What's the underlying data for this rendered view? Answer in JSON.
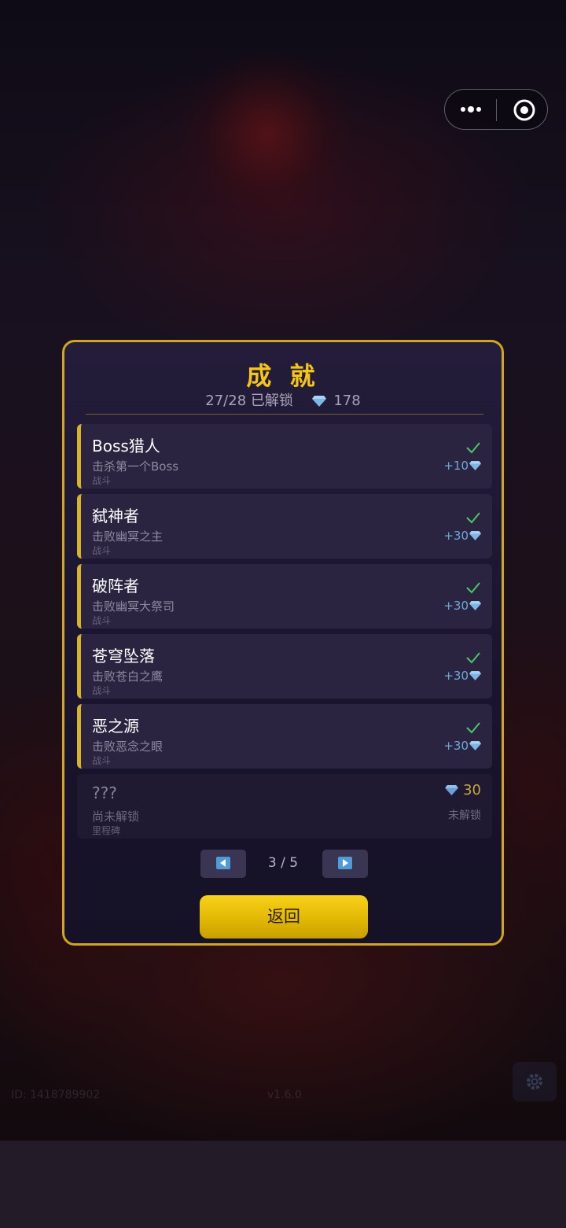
{
  "capsule": {
    "menu_icon": "more-dots-icon",
    "close_icon": "target-circle-icon"
  },
  "panel": {
    "title": "成 就",
    "unlocked_summary": "27/28 已解锁",
    "gem_total": "178",
    "achievements": [
      {
        "name": "Boss猎人",
        "desc": "击杀第一个Boss",
        "category": "战斗",
        "reward": "+10",
        "status": "unlocked"
      },
      {
        "name": "弑神者",
        "desc": "击败幽冥之主",
        "category": "战斗",
        "reward": "+30",
        "status": "unlocked"
      },
      {
        "name": "破阵者",
        "desc": "击败幽冥大祭司",
        "category": "战斗",
        "reward": "+30",
        "status": "unlocked"
      },
      {
        "name": "苍穹坠落",
        "desc": "击败苍白之鹰",
        "category": "战斗",
        "reward": "+30",
        "status": "unlocked"
      },
      {
        "name": "恶之源",
        "desc": "击败恶念之眼",
        "category": "战斗",
        "reward": "+30",
        "status": "unlocked"
      },
      {
        "name": "???",
        "desc": "尚未解锁",
        "category": "里程碑",
        "reward": "30",
        "status_label": "未解锁",
        "status": "locked"
      }
    ],
    "pagination": {
      "label": "3 / 5",
      "current": 3,
      "total": 5
    },
    "back_label": "返回"
  },
  "footer": {
    "id_text": "ID: 1418789902",
    "version": "v1.6.0"
  },
  "colors": {
    "accent_gold": "#f5c518",
    "gem_blue": "#6fa7d8",
    "check_green": "#4cc46a",
    "panel_border": "#d2a520"
  }
}
